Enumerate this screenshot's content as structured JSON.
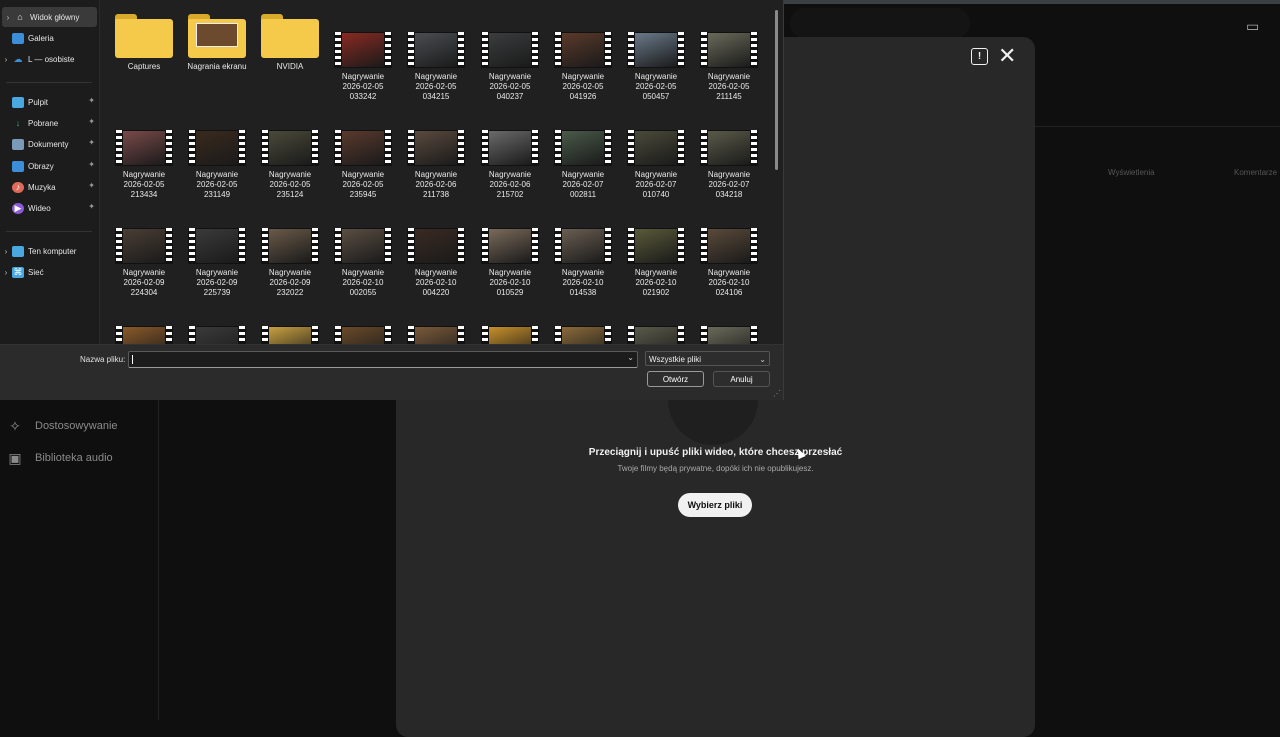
{
  "dialog": {
    "nav": [
      {
        "label": "Widok główny",
        "icon": "home-icon",
        "active": true,
        "chevron": true
      },
      {
        "label": "Galeria",
        "icon": "gallery-icon"
      },
      {
        "label": "L — osobiste",
        "icon": "cloud-icon",
        "chevron": true
      },
      {
        "label": "Pulpit",
        "icon": "desktop-icon",
        "pinned": true
      },
      {
        "label": "Pobrane",
        "icon": "download-icon",
        "pinned": true
      },
      {
        "label": "Dokumenty",
        "icon": "documents-icon",
        "pinned": true
      },
      {
        "label": "Obrazy",
        "icon": "pictures-icon",
        "pinned": true
      },
      {
        "label": "Muzyka",
        "icon": "music-icon",
        "pinned": true
      },
      {
        "label": "Wideo",
        "icon": "video-icon",
        "pinned": true
      },
      {
        "label": "Ten komputer",
        "icon": "computer-icon",
        "chevron": true
      },
      {
        "label": "Sieć",
        "icon": "network-icon",
        "chevron": true
      }
    ],
    "folders": [
      {
        "label": "Captures",
        "type": "folder"
      },
      {
        "label": "Nagrania ekranu",
        "type": "folder-image"
      },
      {
        "label": "NVIDIA",
        "type": "folder"
      }
    ],
    "videos": [
      {
        "label": "Nagrywanie\n2026-02-05\n033242",
        "color": "#8a2a22"
      },
      {
        "label": "Nagrywanie\n2026-02-05\n034215",
        "color": "#4a4e52"
      },
      {
        "label": "Nagrywanie\n2026-02-05\n040237",
        "color": "#3b3d3e"
      },
      {
        "label": "Nagrywanie\n2026-02-05\n041926",
        "color": "#5a3a2a"
      },
      {
        "label": "Nagrywanie\n2026-02-05\n050457",
        "color": "#6a7a8a"
      },
      {
        "label": "Nagrywanie\n2026-02-05\n211145",
        "color": "#6a6a5a"
      },
      {
        "label": "Nagrywanie\n2026-02-05\n213434",
        "color": "#7a4a4a"
      },
      {
        "label": "Nagrywanie\n2026-02-05\n231149",
        "color": "#3a2a1e"
      },
      {
        "label": "Nagrywanie\n2026-02-05\n235124",
        "color": "#4a4a3a"
      },
      {
        "label": "Nagrywanie\n2026-02-05\n235945",
        "color": "#5a3a2e"
      },
      {
        "label": "Nagrywanie\n2026-02-06\n211738",
        "color": "#5a4a3e"
      },
      {
        "label": "Nagrywanie\n2026-02-06\n215702",
        "color": "#6a6a6a"
      },
      {
        "label": "Nagrywanie\n2026-02-07\n002811",
        "color": "#4a5a4a"
      },
      {
        "label": "Nagrywanie\n2026-02-07\n010740",
        "color": "#4a4a3a"
      },
      {
        "label": "Nagrywanie\n2026-02-07\n034218",
        "color": "#5a5a4a"
      },
      {
        "label": "Nagrywanie\n2026-02-09\n224304",
        "color": "#4a3e34"
      },
      {
        "label": "Nagrywanie\n2026-02-09\n225739",
        "color": "#3a3a3a"
      },
      {
        "label": "Nagrywanie\n2026-02-09\n232022",
        "color": "#6a5a48"
      },
      {
        "label": "Nagrywanie\n2026-02-10\n002055",
        "color": "#5a4e42"
      },
      {
        "label": "Nagrywanie\n2026-02-10\n004220",
        "color": "#3a2a22"
      },
      {
        "label": "Nagrywanie\n2026-02-10\n010529",
        "color": "#7a6a5a"
      },
      {
        "label": "Nagrywanie\n2026-02-10\n014538",
        "color": "#6a5e52"
      },
      {
        "label": "Nagrywanie\n2026-02-10\n021902",
        "color": "#5a5a3a"
      },
      {
        "label": "Nagrywanie\n2026-02-10\n024106",
        "color": "#5a4a3a"
      },
      {
        "label": "",
        "color": "#8a5a2a"
      },
      {
        "label": "",
        "color": "#3a3a3a"
      },
      {
        "label": "",
        "color": "#c8a040"
      },
      {
        "label": "",
        "color": "#6a4a2a"
      },
      {
        "label": "",
        "color": "#7a5a3a"
      },
      {
        "label": "",
        "color": "#c8902a"
      },
      {
        "label": "",
        "color": "#8a6a3a"
      },
      {
        "label": "",
        "color": "#5a5a4a"
      },
      {
        "label": "",
        "color": "#6a6a5a"
      }
    ],
    "filename_label": "Nazwa pliku:",
    "filename_value": "",
    "filetype": "Wszystkie pliki",
    "open_label": "Otwórz",
    "cancel_label": "Anuluj"
  },
  "background": {
    "nav": [
      {
        "label": "Dostosowywanie",
        "icon": "wand-icon"
      },
      {
        "label": "Biblioteka audio",
        "icon": "audio-library-icon"
      }
    ],
    "table_headers": [
      "Wyświetlenia",
      "Komentarze"
    ],
    "upload_title": "Przeciągnij i upuść pliki wideo, które chcesz przesłać",
    "upload_subtitle": "Twoje filmy będą prywatne, dopóki ich nie opublikujesz.",
    "select_files_label": "Wybierz pliki"
  }
}
